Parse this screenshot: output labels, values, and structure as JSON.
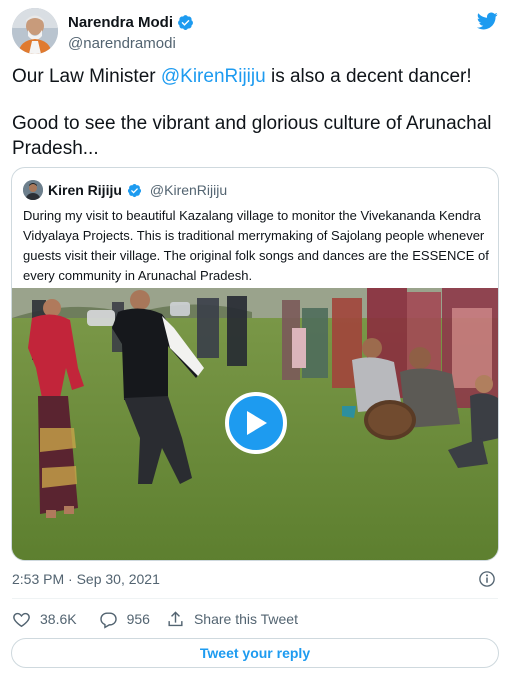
{
  "author": {
    "name": "Narendra Modi",
    "handle": "@narendramodi"
  },
  "tweet": {
    "text_before_mention": "Our Law Minister ",
    "mention": "@KirenRijiju",
    "text_after_mention": " is also a decent dancer!",
    "second_paragraph": "Good to see the vibrant and glorious culture of Arunachal Pradesh..."
  },
  "quoted_tweet": {
    "name": "Kiren Rijiju",
    "handle": "@KirenRijiju",
    "text": "During my visit to beautiful Kazalang village to monitor the Vivekananda Kendra Vidyalaya Projects. This is traditional merrymaking of Sajolang people whenever guests visit their village. The original folk songs and dances are the ESSENCE of every community in Arunachal Pradesh."
  },
  "timestamp": "2:53 PM · Sep 30, 2021",
  "stats": {
    "likes": "38.6K",
    "replies": "956",
    "share_label": "Share this Tweet"
  },
  "reply_button_label": "Tweet your reply",
  "colors": {
    "accent": "#1d9bf0",
    "text": "#0f1419",
    "muted": "#536471",
    "border": "#cfd9de"
  },
  "icons": [
    "verified-badge-icon",
    "twitter-bird-icon",
    "play-icon",
    "info-icon",
    "heart-icon",
    "reply-bubble-icon",
    "share-icon"
  ]
}
